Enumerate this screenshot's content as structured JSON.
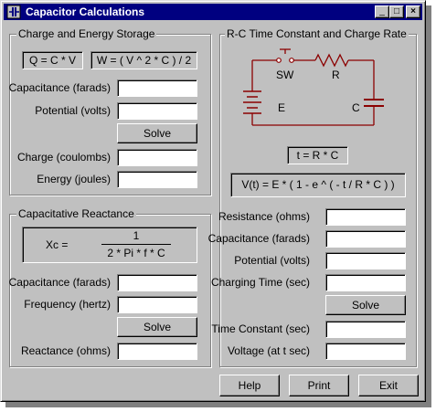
{
  "window": {
    "title": "Capacitor Calculations",
    "controls": {
      "minimize": "_",
      "maximize": "□",
      "close": "×"
    }
  },
  "charge_group": {
    "label": "Charge and Energy Storage",
    "formula_q": "Q = C * V",
    "formula_w": "W = ( V ^ 2 * C ) / 2",
    "capacitance_label": "Capacitance (farads)",
    "potential_label": "Potential (volts)",
    "solve_label": "Solve",
    "charge_label": "Charge (coulombs)",
    "energy_label": "Energy (joules)",
    "values": {
      "capacitance": "",
      "potential": "",
      "charge": "",
      "energy": ""
    }
  },
  "reactance_group": {
    "label": "Capacitative Reactance",
    "formula_lhs": "Xc  =",
    "formula_num": "1",
    "formula_den": "2 * Pi * f * C",
    "capacitance_label": "Capacitance (farads)",
    "frequency_label": "Frequency (hertz)",
    "solve_label": "Solve",
    "reactance_label": "Reactance (ohms)",
    "values": {
      "capacitance": "",
      "frequency": "",
      "reactance": ""
    }
  },
  "rc_group": {
    "label": "R-C Time Constant and Charge Rate",
    "circuit": {
      "sw": "SW",
      "r": "R",
      "e": "E",
      "c": "C"
    },
    "formula_t": "t  =  R * C",
    "formula_v": "V(t)  =  E * ( 1 - e ^ ( - t / R * C ) )",
    "resistance_label": "Resistance (ohms)",
    "capacitance_label": "Capacitance (farads)",
    "potential_label": "Potential (volts)",
    "charging_time_label": "Charging Time (sec)",
    "solve_label": "Solve",
    "time_constant_label": "Time Constant (sec)",
    "voltage_label": "Voltage (at t sec)",
    "values": {
      "resistance": "",
      "capacitance": "",
      "potential": "",
      "charging_time": "",
      "time_constant": "",
      "voltage": ""
    }
  },
  "footer": {
    "help": "Help",
    "print": "Print",
    "exit": "Exit"
  },
  "colors": {
    "title_bar": "#000080",
    "face": "#c0c0c0",
    "circuit": "#8b0000"
  }
}
